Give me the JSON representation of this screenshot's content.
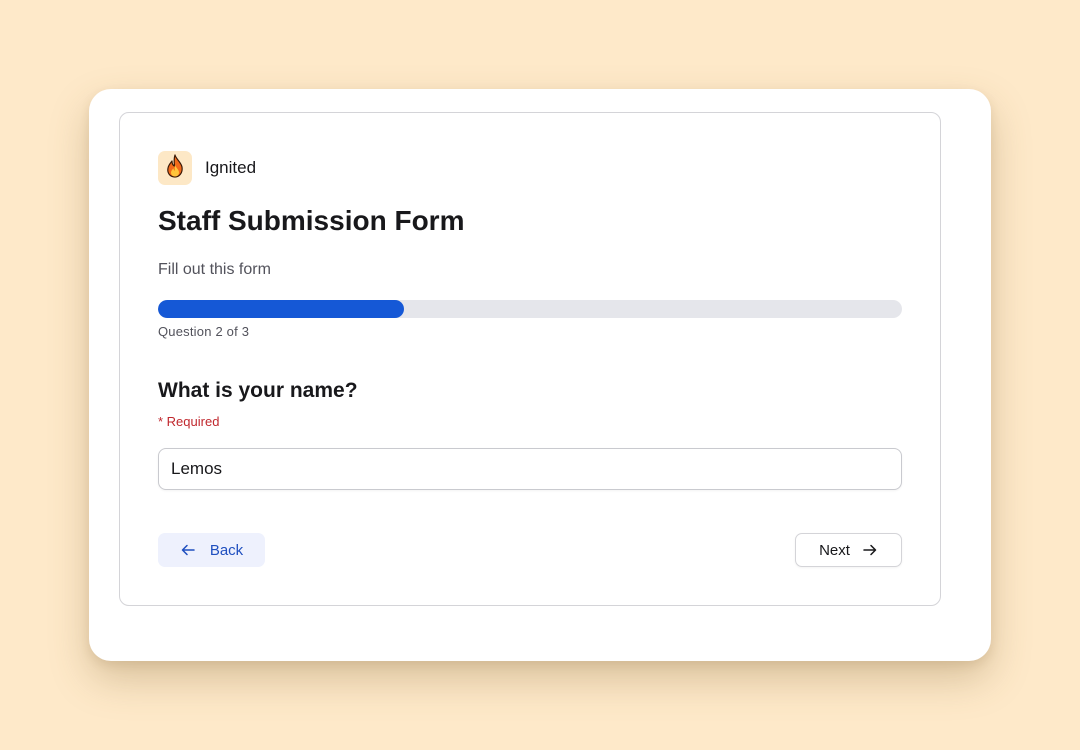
{
  "brand": {
    "name": "Ignited",
    "logo_icon": "flame-icon",
    "logo_bg": "#FDE8C6"
  },
  "form": {
    "title": "Staff Submission Form",
    "description": "Fill out this form"
  },
  "progress": {
    "current": 2,
    "total": 3,
    "fill_fraction": 0.33,
    "label": "Question 2 of 3",
    "fill_color": "#1558D6"
  },
  "question": {
    "title": "What is your name?",
    "required_note": "* Required",
    "answer_value": "Lemos"
  },
  "nav": {
    "back_label": "Back",
    "back_icon": "arrow-left-icon",
    "next_label": "Next",
    "next_icon": "arrow-right-icon"
  },
  "colors": {
    "background": "#FEE9C9",
    "accent": "#1558D6",
    "required": "#C0282E"
  }
}
